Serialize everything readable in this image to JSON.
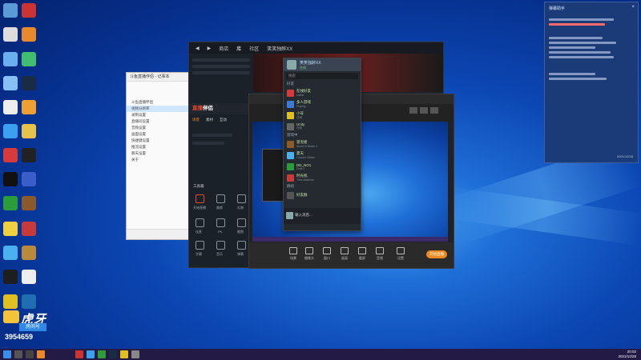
{
  "desktop": {
    "watermark": {
      "brand": "虎牙",
      "subtitle": "房间号",
      "room_number": "3954659"
    }
  },
  "file_window": {
    "title": "斗鱼直播伴侣 - 记事本",
    "rows": [
      "斗鱼直播伴侣",
      "视频分辨率",
      "录制设置",
      "直播间设置",
      "音频设置",
      "画面设置",
      "快捷键设置",
      "推流设置",
      "聊天设置",
      "关于"
    ]
  },
  "steam": {
    "nav": [
      "商店",
      "库",
      "社区",
      "笑笑独醉XX"
    ],
    "active_nav": "库",
    "brand_prefix": "直播",
    "brand_suffix": "伴侣",
    "tabs": [
      "场景",
      "素材",
      "互动"
    ],
    "toolbar_label": "工具箱",
    "tools": [
      "开始直播",
      "美颜",
      "礼物",
      "连麦",
      "PK",
      "截图",
      "字幕",
      "音乐",
      "弹幕",
      "设置",
      "录像",
      "分享"
    ]
  },
  "chat": {
    "user": "笑笑独醉XX",
    "status": "在线",
    "search_placeholder": "搜索",
    "section_friends": "好友",
    "section_online": "游戏中",
    "section_groups": "群组",
    "friends": [
      {
        "name": "在线好友",
        "status": "online"
      },
      {
        "name": "多人游戏",
        "status": "Playing"
      },
      {
        "name": "小号",
        "status": "在线"
      },
      {
        "name": "Unity",
        "status": "在线"
      }
    ],
    "ingame": [
      {
        "name": "冒泡者",
        "status": "Mount & Blade II"
      },
      {
        "name": "夏天",
        "status": "Counter-Strike"
      },
      {
        "name": "DD_NO1",
        "status": "Dota 2"
      },
      {
        "name": "时光机",
        "status": "Time Machine"
      }
    ],
    "groups": [
      {
        "name": "好友群"
      }
    ],
    "message": "输入消息..."
  },
  "stream": {
    "controls": [
      "场景",
      "摄像头",
      "窗口",
      "画面",
      "截屏",
      "音频",
      "设置"
    ],
    "start_button": "开始直播"
  },
  "notification": {
    "title": "弹幕助手",
    "lines_count": 9,
    "time": "2021/12/28"
  },
  "taskbar": {
    "clock_time": "20:02",
    "clock_date": "2021/12/28"
  }
}
